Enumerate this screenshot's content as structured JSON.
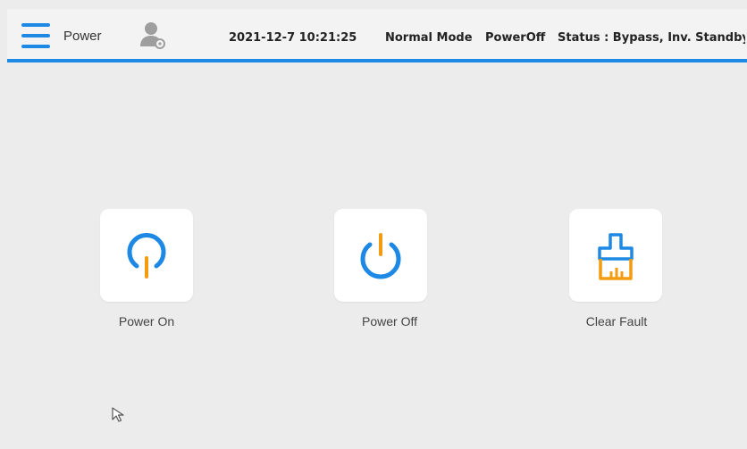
{
  "header": {
    "title": "Power",
    "datetime": "2021-12-7 10:21:25",
    "mode": "Normal Mode",
    "power_state": "PowerOff",
    "status": "Status : Bypass, Inv. Standby"
  },
  "actions": [
    {
      "label": "Power On",
      "icon": "power-on-icon"
    },
    {
      "label": "Power Off",
      "icon": "power-off-icon"
    },
    {
      "label": "Clear Fault",
      "icon": "brush-icon"
    }
  ],
  "colors": {
    "accent": "#1e88e5",
    "secondary": "#f39c12",
    "background": "#ececec",
    "tile": "#ffffff"
  }
}
